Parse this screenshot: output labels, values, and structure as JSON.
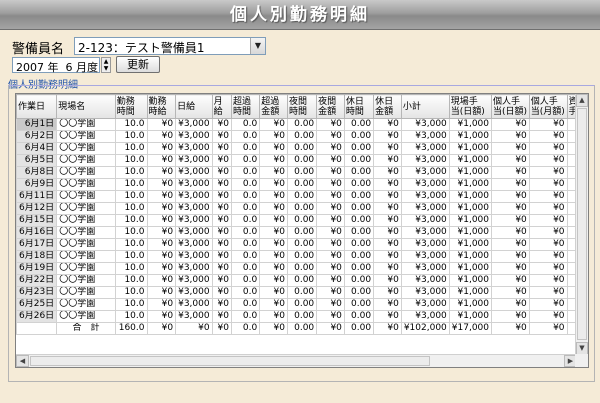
{
  "title": "個人別勤務明細",
  "guard": {
    "label": "警備員名",
    "selected": "2-123：テスト警備員1"
  },
  "period": {
    "year": "2007",
    "year_unit": "年",
    "month": "6",
    "month_unit": "月度",
    "update_label": "更新"
  },
  "section_label": "個人別勤務明細",
  "table": {
    "columns": [
      "作業日",
      "現場名",
      "勤務\n時間",
      "勤務\n時給",
      "日給",
      "月\n給",
      "超過\n時間",
      "超過\n金額",
      "夜間\n時間",
      "夜間\n金額",
      "休日\n時間",
      "休日\n金額",
      "小計",
      "現場手\n当(日額)",
      "個人手\n当(日額)",
      "個人手\n当(月額)",
      "資\n手"
    ],
    "rows": [
      [
        "6月1日",
        "〇〇学園",
        "10.0",
        "¥0",
        "¥3,000",
        "¥0",
        "0.0",
        "¥0",
        "0.00",
        "¥0",
        "0.00",
        "¥0",
        "¥3,000",
        "¥1,000",
        "¥0",
        "¥0",
        ""
      ],
      [
        "6月2日",
        "〇〇学園",
        "10.0",
        "¥0",
        "¥3,000",
        "¥0",
        "0.0",
        "¥0",
        "0.00",
        "¥0",
        "0.00",
        "¥0",
        "¥3,000",
        "¥1,000",
        "¥0",
        "¥0",
        ""
      ],
      [
        "6月4日",
        "〇〇学園",
        "10.0",
        "¥0",
        "¥3,000",
        "¥0",
        "0.0",
        "¥0",
        "0.00",
        "¥0",
        "0.00",
        "¥0",
        "¥3,000",
        "¥1,000",
        "¥0",
        "¥0",
        ""
      ],
      [
        "6月5日",
        "〇〇学園",
        "10.0",
        "¥0",
        "¥3,000",
        "¥0",
        "0.0",
        "¥0",
        "0.00",
        "¥0",
        "0.00",
        "¥0",
        "¥3,000",
        "¥1,000",
        "¥0",
        "¥0",
        ""
      ],
      [
        "6月8日",
        "〇〇学園",
        "10.0",
        "¥0",
        "¥3,000",
        "¥0",
        "0.0",
        "¥0",
        "0.00",
        "¥0",
        "0.00",
        "¥0",
        "¥3,000",
        "¥1,000",
        "¥0",
        "¥0",
        ""
      ],
      [
        "6月9日",
        "〇〇学園",
        "10.0",
        "¥0",
        "¥3,000",
        "¥0",
        "0.0",
        "¥0",
        "0.00",
        "¥0",
        "0.00",
        "¥0",
        "¥3,000",
        "¥1,000",
        "¥0",
        "¥0",
        ""
      ],
      [
        "6月11日",
        "〇〇学園",
        "10.0",
        "¥0",
        "¥3,000",
        "¥0",
        "0.0",
        "¥0",
        "0.00",
        "¥0",
        "0.00",
        "¥0",
        "¥3,000",
        "¥1,000",
        "¥0",
        "¥0",
        ""
      ],
      [
        "6月12日",
        "〇〇学園",
        "10.0",
        "¥0",
        "¥3,000",
        "¥0",
        "0.0",
        "¥0",
        "0.00",
        "¥0",
        "0.00",
        "¥0",
        "¥3,000",
        "¥1,000",
        "¥0",
        "¥0",
        ""
      ],
      [
        "6月15日",
        "〇〇学園",
        "10.0",
        "¥0",
        "¥3,000",
        "¥0",
        "0.0",
        "¥0",
        "0.00",
        "¥0",
        "0.00",
        "¥0",
        "¥3,000",
        "¥1,000",
        "¥0",
        "¥0",
        ""
      ],
      [
        "6月16日",
        "〇〇学園",
        "10.0",
        "¥0",
        "¥3,000",
        "¥0",
        "0.0",
        "¥0",
        "0.00",
        "¥0",
        "0.00",
        "¥0",
        "¥3,000",
        "¥1,000",
        "¥0",
        "¥0",
        ""
      ],
      [
        "6月17日",
        "〇〇学園",
        "10.0",
        "¥0",
        "¥3,000",
        "¥0",
        "0.0",
        "¥0",
        "0.00",
        "¥0",
        "0.00",
        "¥0",
        "¥3,000",
        "¥1,000",
        "¥0",
        "¥0",
        ""
      ],
      [
        "6月18日",
        "〇〇学園",
        "10.0",
        "¥0",
        "¥3,000",
        "¥0",
        "0.0",
        "¥0",
        "0.00",
        "¥0",
        "0.00",
        "¥0",
        "¥3,000",
        "¥1,000",
        "¥0",
        "¥0",
        ""
      ],
      [
        "6月19日",
        "〇〇学園",
        "10.0",
        "¥0",
        "¥3,000",
        "¥0",
        "0.0",
        "¥0",
        "0.00",
        "¥0",
        "0.00",
        "¥0",
        "¥3,000",
        "¥1,000",
        "¥0",
        "¥0",
        ""
      ],
      [
        "6月22日",
        "〇〇学園",
        "10.0",
        "¥0",
        "¥3,000",
        "¥0",
        "0.0",
        "¥0",
        "0.00",
        "¥0",
        "0.00",
        "¥0",
        "¥3,000",
        "¥1,000",
        "¥0",
        "¥0",
        ""
      ],
      [
        "6月23日",
        "〇〇学園",
        "10.0",
        "¥0",
        "¥3,000",
        "¥0",
        "0.0",
        "¥0",
        "0.00",
        "¥0",
        "0.00",
        "¥0",
        "¥3,000",
        "¥1,000",
        "¥0",
        "¥0",
        ""
      ],
      [
        "6月25日",
        "〇〇学園",
        "10.0",
        "¥0",
        "¥3,000",
        "¥0",
        "0.0",
        "¥0",
        "0.00",
        "¥0",
        "0.00",
        "¥0",
        "¥3,000",
        "¥1,000",
        "¥0",
        "¥0",
        ""
      ],
      [
        "6月26日",
        "〇〇学園",
        "10.0",
        "¥0",
        "¥3,000",
        "¥0",
        "0.0",
        "¥0",
        "0.00",
        "¥0",
        "0.00",
        "¥0",
        "¥3,000",
        "¥1,000",
        "¥0",
        "¥0",
        ""
      ]
    ],
    "total": [
      "",
      "合　計",
      "160.0",
      "¥0",
      "¥0",
      "¥0",
      "0.0",
      "¥0",
      "0.00",
      "¥0",
      "0.00",
      "¥0",
      "¥102,000",
      "¥17,000",
      "¥0",
      "¥0",
      ""
    ],
    "selected_row": 0
  },
  "icons": {
    "dropdown": "chevron-down-icon",
    "spin_up": "spin-up-icon",
    "spin_down": "spin-down-icon"
  }
}
